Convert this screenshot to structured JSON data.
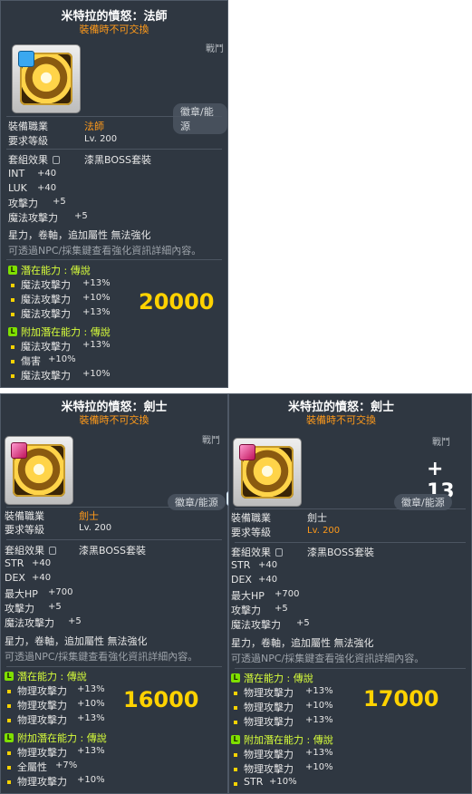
{
  "mage": {
    "title": "米特拉的憤怒：法師",
    "untradeable": "裝備時不可交換",
    "corner_text": "戰鬥",
    "button_label": "徽章/能源",
    "job_label": "裝備職業",
    "job_value": "法師",
    "req_label": "要求等級",
    "req_value": "Lv. 200",
    "set_label": "套組效果",
    "set_value": "漆黑BOSS套裝",
    "stats": [
      {
        "name": "INT",
        "value": "+40"
      },
      {
        "name": "LUK",
        "value": "+40"
      },
      {
        "name": "攻擊力",
        "value": "+5"
      },
      {
        "name": "魔法攻擊力",
        "value": "+5"
      }
    ],
    "enhance_line": "星力，卷軸，追加屬性 無法強化",
    "npc_line": "可透過NPC/採集鍵查看強化資訊詳細內容。",
    "potential_title": "潛在能力 : 傳說",
    "potential": [
      {
        "name": "魔法攻擊力",
        "value": "+13%"
      },
      {
        "name": "魔法攻擊力",
        "value": "+10%"
      },
      {
        "name": "魔法攻擊力",
        "value": "+13%"
      }
    ],
    "bonus_title": "附加潛在能力 : 傳說",
    "bonus": [
      {
        "name": "魔法攻擊力",
        "value": "+13%"
      },
      {
        "name": "傷害",
        "value": "+10%"
      },
      {
        "name": "魔法攻擊力",
        "value": "+10%"
      }
    ],
    "price": "20000"
  },
  "warrior1": {
    "title": "米特拉的憤怒：劍士",
    "untradeable": "裝備時不可交換",
    "corner_text": "戰鬥",
    "button_label": "徽章/能源",
    "job_label": "裝備職業",
    "job_value": "劍士",
    "req_label": "要求等級",
    "req_value": "Lv. 200",
    "set_label": "套組效果",
    "set_value": "漆黑BOSS套裝",
    "stats": [
      {
        "name": "STR",
        "value": "+40"
      },
      {
        "name": "DEX",
        "value": "+40"
      },
      {
        "name": "最大HP",
        "value": "+700"
      },
      {
        "name": "攻擊力",
        "value": "+5"
      },
      {
        "name": "魔法攻擊力",
        "value": "+5"
      }
    ],
    "enhance_line": "星力，卷軸，追加屬性 無法強化",
    "npc_line": "可透過NPC/採集鍵查看強化資訊詳細內容。",
    "potential_title": "潛在能力 : 傳說",
    "potential": [
      {
        "name": "物理攻擊力",
        "value": "+13%"
      },
      {
        "name": "物理攻擊力",
        "value": "+10%"
      },
      {
        "name": "物理攻擊力",
        "value": "+13%"
      }
    ],
    "bonus_title": "附加潛在能力 : 傳說",
    "bonus": [
      {
        "name": "物理攻擊力",
        "value": "+13%"
      },
      {
        "name": "全屬性",
        "value": "+7%"
      },
      {
        "name": "物理攻擊力",
        "value": "+10%"
      }
    ],
    "price": "16000"
  },
  "warrior2": {
    "title": "米特拉的憤怒：劍士",
    "untradeable": "裝備時不可交換",
    "corner_text": "戰鬥",
    "plus_text": "+ 13",
    "button_label": "徽章/能源",
    "job_label": "裝備職業",
    "job_value": "劍士",
    "req_label": "要求等級",
    "req_value": "Lv. 200",
    "set_label": "套組效果",
    "set_value": "漆黑BOSS套裝",
    "stats": [
      {
        "name": "STR",
        "value": "+40"
      },
      {
        "name": "DEX",
        "value": "+40"
      },
      {
        "name": "最大HP",
        "value": "+700"
      },
      {
        "name": "攻擊力",
        "value": "+5"
      },
      {
        "name": "魔法攻擊力",
        "value": "+5"
      }
    ],
    "enhance_line": "星力，卷軸，追加屬性 無法強化",
    "npc_line": "可透過NPC/採集鍵查看強化資訊詳細內容。",
    "potential_title": "潛在能力 : 傳說",
    "potential": [
      {
        "name": "物理攻擊力",
        "value": "+13%"
      },
      {
        "name": "物理攻擊力",
        "value": "+10%"
      },
      {
        "name": "物理攻擊力",
        "value": "+13%"
      }
    ],
    "bonus_title": "附加潛在能力 : 傳說",
    "bonus": [
      {
        "name": "物理攻擊力",
        "value": "+13%"
      },
      {
        "name": "物理攻擊力",
        "value": "+10%"
      },
      {
        "name": "STR",
        "value": "+10%"
      }
    ],
    "price": "17000"
  },
  "icons": {
    "emblem": "emblem-icon",
    "badge": "badge-icon",
    "lock": "lock-icon",
    "tier": "legendary-tier-icon"
  },
  "colors": {
    "panel_bg": "#2f3741",
    "highlight": "#ff9a1a",
    "tier_green": "#7fe000",
    "tier_title": "#d8ff3a",
    "price": "#ffd200"
  }
}
